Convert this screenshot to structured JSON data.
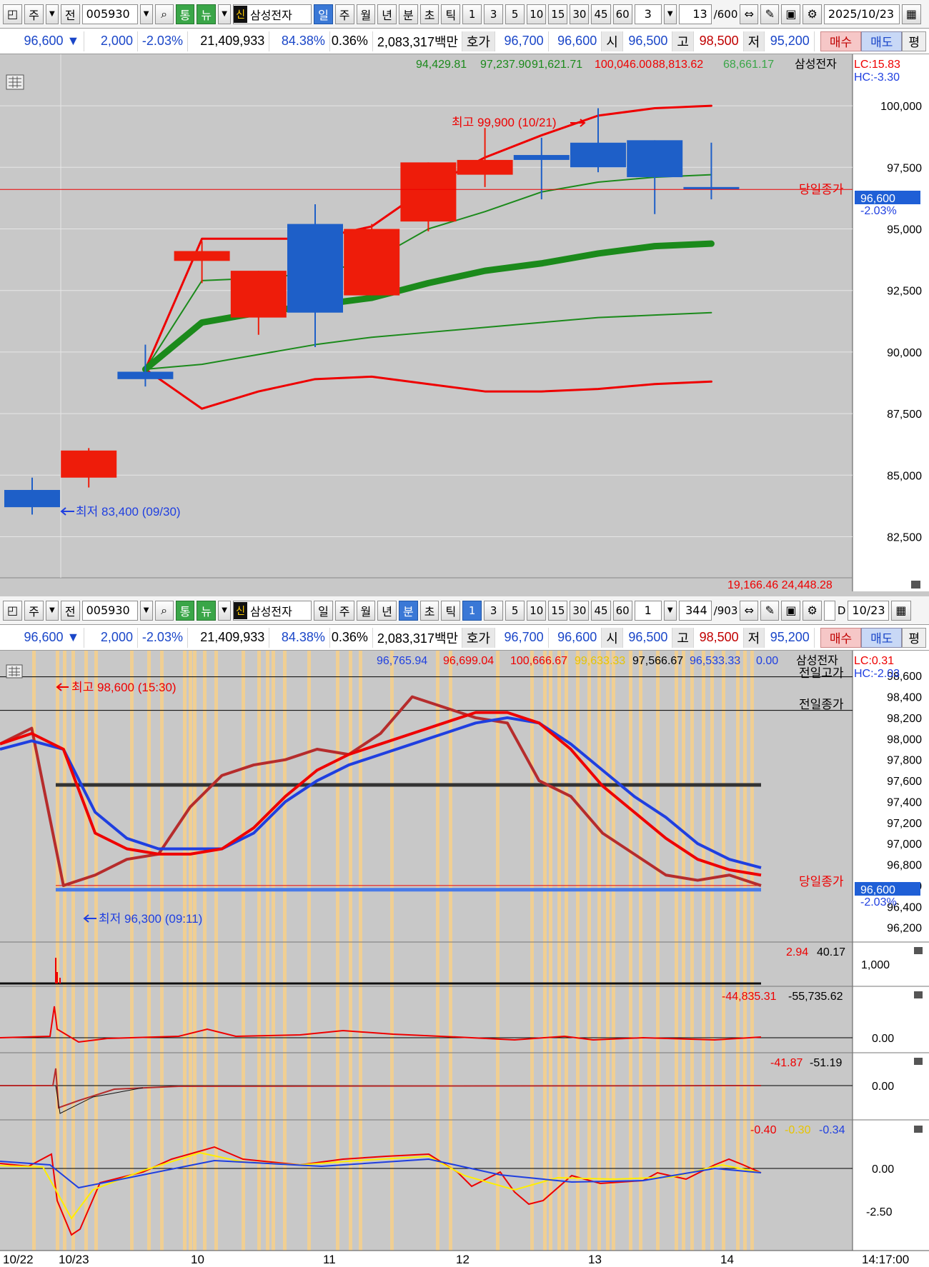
{
  "top": {
    "toolbar": {
      "type_label": "주",
      "prev_label": "전",
      "code": "005930",
      "tong": "통",
      "nyu": "뉴",
      "sin": "신",
      "stock_name": "삼성전자",
      "periods": [
        "일",
        "주",
        "월",
        "년",
        "분",
        "초",
        "틱"
      ],
      "active_period": "일",
      "intervals": [
        "1",
        "3",
        "5",
        "10",
        "15",
        "30",
        "45",
        "60"
      ],
      "interval_value": "3",
      "count": "13",
      "count_total": "/600",
      "date": "2025/10/23"
    },
    "quote": {
      "price": "96,600 ▼",
      "change": "2,000",
      "change_pct": "-2.03%",
      "volume": "21,409,933",
      "vol_ratio": "84.38%",
      "turnover": "0.36%",
      "amount": "2,083,317백만",
      "hoga_label": "호가",
      "ask": "96,700",
      "bid": "96,600",
      "open_label": "시",
      "open": "96,500",
      "high_label": "고",
      "high": "98,500",
      "low_label": "저",
      "low": "95,200",
      "buy": "매수",
      "sell": "매도",
      "avg": "평"
    },
    "legend": {
      "ma1": "94,429.81",
      "ma2": "97,237.90",
      "ma3": "91,621.71",
      "ma4": "100,046.00",
      "ma5": "88,813.62",
      "ma6": "68,661.17",
      "name": "삼성전자",
      "lc": "LC:15.83",
      "hc": "HC:-3.30"
    },
    "labels": {
      "high_note": "최고 99,900 (10/21)",
      "low_note": "최저 83,400 (09/30)",
      "close_label": "당일종가",
      "price_tag": "96,600",
      "pct_tag": "-2.03%",
      "bottom_readout": "19,166.46  24,448.28"
    }
  },
  "bottom": {
    "toolbar": {
      "interval_value": "1",
      "count": "344",
      "count_total": "/903",
      "active_period": "분",
      "d_label": "D",
      "date": "10/23"
    },
    "legend": {
      "v1": "96,765.94",
      "v2": "96,699.04",
      "v3": "100,666.67",
      "v4": "99,633.33",
      "v5": "97,566.67",
      "v6": "96,533.33",
      "v7": "0.00",
      "name": "삼성전자",
      "lc": "LC:0.31",
      "hc": "HC:-2.03"
    },
    "labels": {
      "high_note": "최고 98,600 (15:30)",
      "low_note": "최저 96,300 (09:11)",
      "prev_high": "전일고가",
      "prev_close": "전일종가",
      "close_label": "당일종가",
      "price_tag": "96,600",
      "pct_tag": "-2.03%"
    },
    "subpanels": {
      "vol_legend_a": "2.94",
      "vol_legend_b": "40.17",
      "vol_axis": "1,000",
      "p2_legend_a": "-44,835.31",
      "p2_legend_b": "-55,735.62",
      "p2_axis": "0.00",
      "p3_legend_a": "-41.87",
      "p3_legend_b": "-51.19",
      "p3_axis": "0.00",
      "p4_legend_a": "-0.40",
      "p4_legend_b": "-0.30",
      "p4_legend_c": "-0.34",
      "p4_axis_a": "0.00",
      "p4_axis_b": "-2.50"
    },
    "time_axis": {
      "labels": [
        "10/22",
        "10/23",
        "10",
        "11",
        "12",
        "13",
        "14"
      ],
      "clock": "14:17:00"
    }
  },
  "chart_data": [
    {
      "type": "candlestick",
      "title": "",
      "y_axis_ticks": [
        "82,500",
        "85,000",
        "87,500",
        "90,000",
        "92,500",
        "95,000",
        "97,500",
        "100,000"
      ],
      "ylim": [
        81500,
        101800
      ],
      "candles": [
        {
          "open": 84400,
          "high": 84900,
          "low": 83400,
          "close": 83700
        },
        {
          "open": 84900,
          "high": 86100,
          "low": 84500,
          "close": 86000
        },
        {
          "open": 89200,
          "high": 90300,
          "low": 88600,
          "close": 88900
        },
        {
          "open": 93700,
          "high": 94500,
          "low": 92800,
          "close": 94100
        },
        {
          "open": 91400,
          "high": 93300,
          "low": 90700,
          "close": 93300
        },
        {
          "open": 95200,
          "high": 96000,
          "low": 90200,
          "close": 91600
        },
        {
          "open": 92300,
          "high": 95200,
          "low": 92300,
          "close": 95000
        },
        {
          "open": 95300,
          "high": 97700,
          "low": 94900,
          "close": 97700
        },
        {
          "open": 97200,
          "high": 99100,
          "low": 96700,
          "close": 97800
        },
        {
          "open": 98000,
          "high": 98700,
          "low": 96200,
          "close": 97800
        },
        {
          "open": 98500,
          "high": 99900,
          "low": 97300,
          "close": 97500
        },
        {
          "open": 98600,
          "high": 98600,
          "low": 95600,
          "close": 97100
        },
        {
          "open": 96700,
          "high": 98500,
          "low": 96200,
          "close": 96600
        }
      ],
      "overlays": [
        {
          "color": "#ee0000",
          "width": 3,
          "values": [
            89300,
            94600,
            94600,
            94600,
            95100,
            96700,
            97900,
            98800,
            99600,
            99900,
            100000
          ]
        },
        {
          "color": "#ee0000",
          "width": 3,
          "values": [
            89300,
            87700,
            88400,
            88900,
            89000,
            88700,
            88400,
            88400,
            88500,
            88700,
            88800
          ]
        },
        {
          "color": "#1b8a1b",
          "width": 2,
          "values": [
            89300,
            92900,
            93000,
            93200,
            93700,
            95000,
            95700,
            96500,
            96900,
            97100,
            97200
          ]
        },
        {
          "color": "#1b8a1b",
          "width": 2,
          "values": [
            89300,
            89500,
            89900,
            90300,
            90600,
            90800,
            91000,
            91200,
            91400,
            91500,
            91600
          ]
        },
        {
          "color": "#1b8a1b",
          "width": 9,
          "values": [
            89300,
            91200,
            91600,
            91900,
            92200,
            92800,
            93300,
            93600,
            94000,
            94300,
            94400
          ]
        }
      ],
      "hlines": [
        {
          "value": 96600,
          "color": "#ee0000"
        }
      ]
    },
    {
      "type": "line",
      "title": "",
      "y_axis_ticks": [
        "96,200",
        "96,400",
        "96,600",
        "96,800",
        "97,000",
        "97,200",
        "97,400",
        "97,600",
        "97,800",
        "98,000",
        "98,200",
        "98,400",
        "98,600"
      ],
      "ylim": [
        96150,
        98690
      ],
      "series": [
        {
          "color": "#ee0000",
          "values": [
            97950,
            98050,
            97900,
            97100,
            96950,
            96900,
            96900,
            96950,
            97150,
            97450,
            97700,
            97850,
            97950,
            98050,
            98150,
            98250,
            98250,
            98150,
            97900,
            97550,
            97300,
            97050,
            96850,
            96750,
            96700
          ]
        },
        {
          "color": "#1f3fe0",
          "values": [
            97900,
            97980,
            97900,
            97300,
            97050,
            96950,
            96950,
            96950,
            97100,
            97400,
            97600,
            97750,
            97850,
            97950,
            98050,
            98150,
            98200,
            98150,
            97950,
            97700,
            97450,
            97250,
            97000,
            96850,
            96770
          ]
        },
        {
          "color": "#b62c2c",
          "values": [
            97950,
            98100,
            96600,
            96700,
            96850,
            96900,
            97350,
            97650,
            97750,
            97800,
            97900,
            97850,
            98050,
            98400,
            98300,
            98200,
            98150,
            97600,
            97450,
            97100,
            96900,
            96700,
            96650,
            96700,
            96600
          ]
        }
      ],
      "hlines": [
        {
          "value": 98590,
          "color": "#000000"
        },
        {
          "value": 98270,
          "color": "#000000"
        },
        {
          "value": 97560,
          "color": "#333333"
        },
        {
          "value": 96600,
          "color": "#ee0000"
        },
        {
          "value": 96560,
          "color": "#4a7be8"
        }
      ]
    }
  ]
}
